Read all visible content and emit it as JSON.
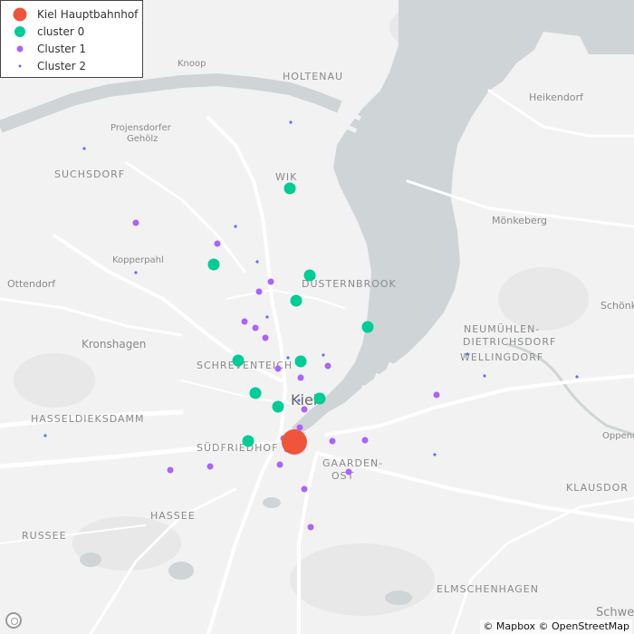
{
  "legend": {
    "items": [
      {
        "label": "Kiel Hauptbahnhof",
        "color": "#ef553b",
        "marker": "large-circle"
      },
      {
        "label": "cluster 0",
        "color": "#00cc96",
        "marker": "medium-circle"
      },
      {
        "label": "Cluster 1",
        "color": "#ab63fa",
        "marker": "small-circle"
      },
      {
        "label": "Cluster 2",
        "color": "#636efa",
        "marker": "tiny-dot"
      }
    ]
  },
  "place_labels": [
    {
      "text": "HOLTENAU"
    },
    {
      "text": "Knoop"
    },
    {
      "text": "Heikendorf"
    },
    {
      "text": "Projensdorfer"
    },
    {
      "text": "Gehölz"
    },
    {
      "text": "SUCHSDORF"
    },
    {
      "text": "WIK"
    },
    {
      "text": "Mönkeberg"
    },
    {
      "text": "Kopperpahl"
    },
    {
      "text": "Ottendorf"
    },
    {
      "text": "DÜSTERNBROOK"
    },
    {
      "text": "Schönk"
    },
    {
      "text": "NEUMÜHLEN-"
    },
    {
      "text": "DIETRICHSDORF"
    },
    {
      "text": "Kronshagen"
    },
    {
      "text": "SCHREVENTEICH"
    },
    {
      "text": "WELLINGDORF"
    },
    {
      "text": "Kiel"
    },
    {
      "text": "HASSELDIEKSDAMM"
    },
    {
      "text": "Oppend"
    },
    {
      "text": "SÜDFRIEDHOF"
    },
    {
      "text": "GAARDEN-"
    },
    {
      "text": "OST"
    },
    {
      "text": "KLAUSDOR"
    },
    {
      "text": "HASSEE"
    },
    {
      "text": "RUSSEE"
    },
    {
      "text": "ELMSCHENHAGEN"
    },
    {
      "text": "Schwe"
    }
  ],
  "points": {
    "hauptbahnhof": [
      {
        "cluster": "Kiel Hauptbahnhof"
      }
    ],
    "cluster0_count": 14,
    "cluster1_count": 26,
    "cluster2_count": 14
  },
  "attribution": "© Mapbox © OpenStreetMap",
  "colors": {
    "land": "#f2f2f2",
    "water": "#cfd4d6",
    "park": "#e6e6e6",
    "road": "#ffffff"
  }
}
